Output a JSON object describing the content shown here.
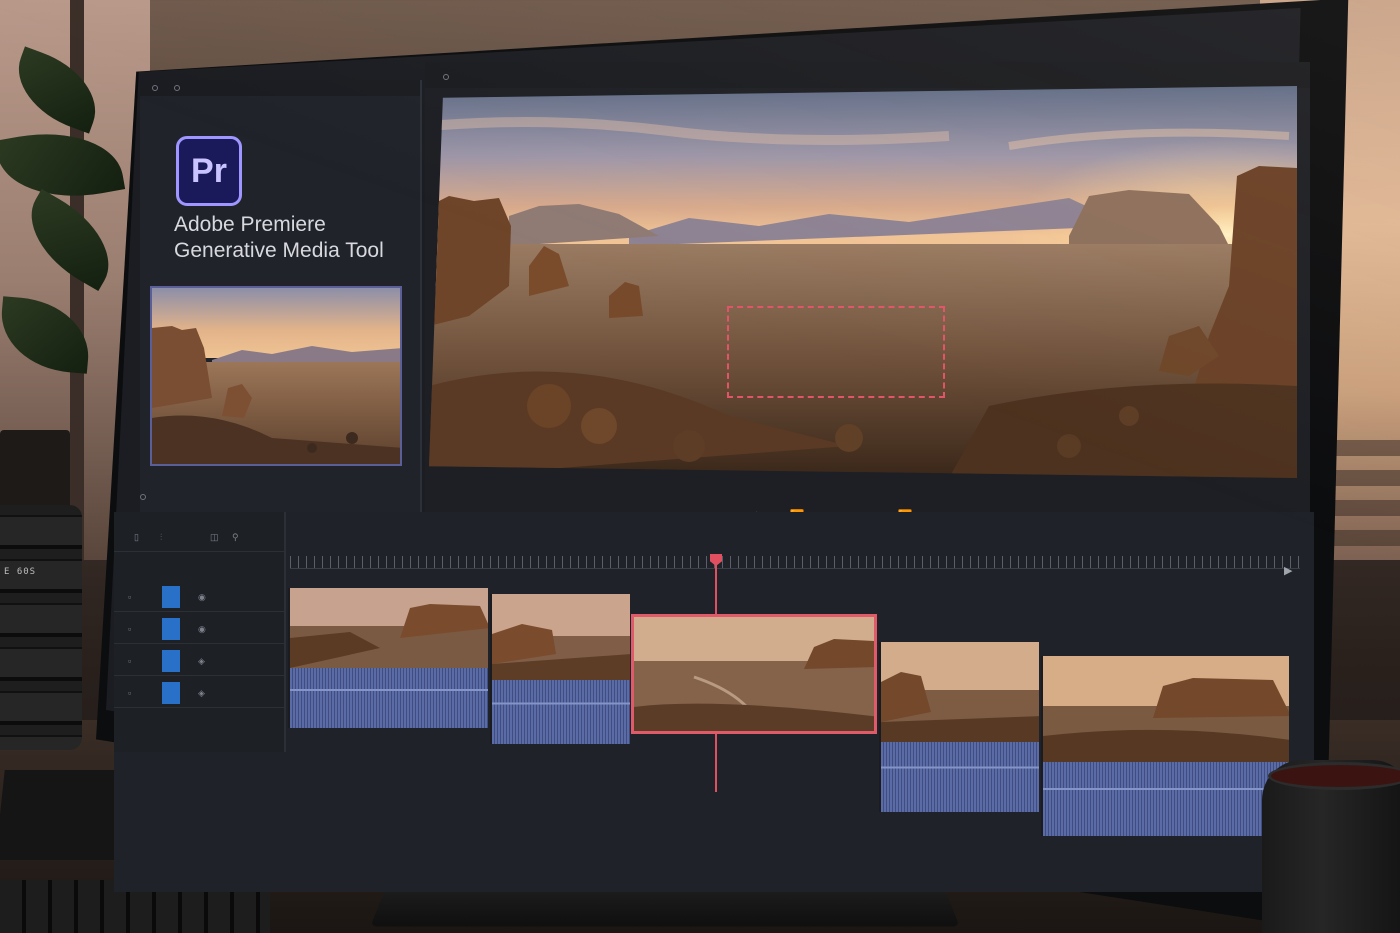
{
  "app": {
    "logo_text": "Pr",
    "title_line1": "Adobe Premiere",
    "title_line2": "Generative Media Tool"
  },
  "lens": {
    "label": "E 60S"
  },
  "program_monitor": {
    "transport_icons": [
      "skip-start-icon",
      "step-back-icon",
      "go-to-in-icon",
      "prev-edit-icon",
      "stop-icon",
      "play-icon",
      "fast-forward-icon",
      "skip-end-icon"
    ]
  },
  "timeline": {
    "clip_count": 5,
    "selected_clip_index": 2
  },
  "colors": {
    "accent": "#e05a6a",
    "track_target": "#2870c8",
    "pr_logo_bg": "#1a1a5b",
    "pr_logo_border": "#9f97ff"
  }
}
